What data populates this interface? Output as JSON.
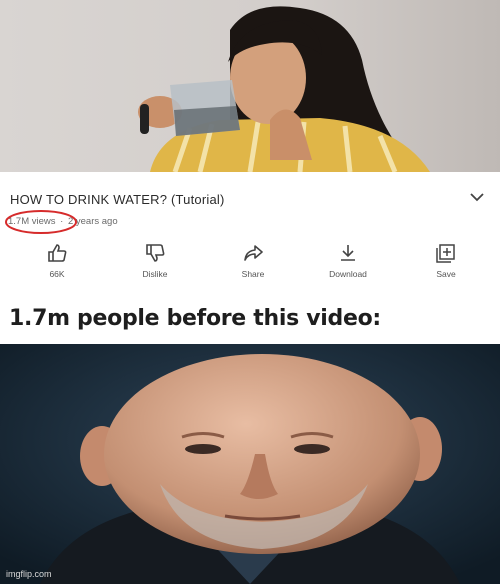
{
  "video": {
    "title": "HOW TO DRINK WATER? (Tutorial)",
    "views": "1.7M views",
    "separator": "·",
    "age": "2 years ago"
  },
  "actions": [
    {
      "label": "66K",
      "icon": "thumbs-up-icon"
    },
    {
      "label": "Dislike",
      "icon": "thumbs-down-icon"
    },
    {
      "label": "Share",
      "icon": "share-icon"
    },
    {
      "label": "Download",
      "icon": "download-icon"
    },
    {
      "label": "Save",
      "icon": "playlist-add-icon"
    }
  ],
  "caption": "1.7m people before this video:",
  "watermark": "imgflip.com",
  "colors": {
    "highlight_circle": "#d62b2b",
    "icon": "#444444",
    "bottom_background": "#1a2b39"
  }
}
